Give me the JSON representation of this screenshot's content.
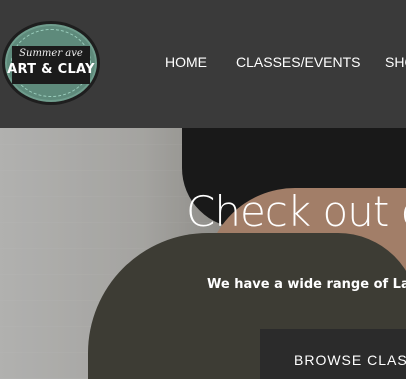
{
  "logo": {
    "script_text": "Summer ave",
    "main_text": "ART & CLAY",
    "colors": {
      "ring": "#5e8a7b",
      "band": "#1b1b1b"
    }
  },
  "nav": {
    "items": [
      {
        "label": "HOME"
      },
      {
        "label": "CLASSES/EVENTS"
      },
      {
        "label": "SHOP"
      }
    ]
  },
  "hero": {
    "title": "Check out our",
    "subtitle": "We have a wide range of Lagunas",
    "cta_label": "BROWSE CLASSES"
  },
  "colors": {
    "header_bg": "#3a3a3a",
    "cta_bg": "#2b2b2b",
    "text": "#ffffff"
  }
}
